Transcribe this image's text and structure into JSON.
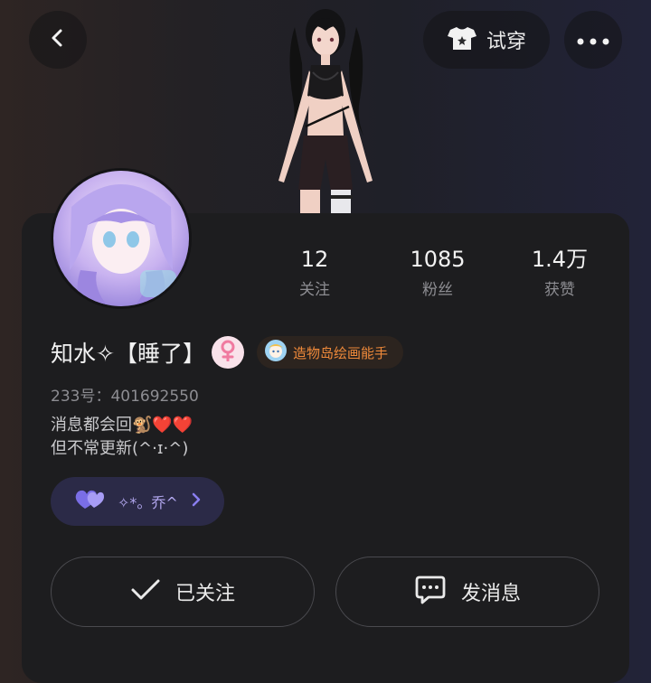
{
  "header": {
    "back_icon": "chevron-left-icon",
    "tryon_label": "试穿",
    "tryon_icon": "shirt-icon",
    "more_icon": "more-dots-icon"
  },
  "profile": {
    "name": "知水✧【睡了】",
    "uid_label": "233号：401692550",
    "bio_line1": "消息都会回🐒❤️❤️",
    "bio_line2": "但不常更新(^·ɪ·^)",
    "gender_icon": "female-icon",
    "badge_label": "造物岛绘画能手"
  },
  "stats": [
    {
      "value": "12",
      "label": "关注"
    },
    {
      "value": "1085",
      "label": "粉丝"
    },
    {
      "value": "1.4万",
      "label": "获赞"
    }
  ],
  "tag": {
    "label": "✧*。乔^",
    "icon": "heart-icon"
  },
  "actions": {
    "follow_label": "已关注",
    "message_label": "发消息"
  },
  "colors": {
    "card_bg": "#1d1d1f",
    "badge_text": "#f08a3a",
    "tag_bg": "#2b2a47",
    "tag_accent": "#8a7ef0",
    "gender_pink": "#f07aa0"
  }
}
